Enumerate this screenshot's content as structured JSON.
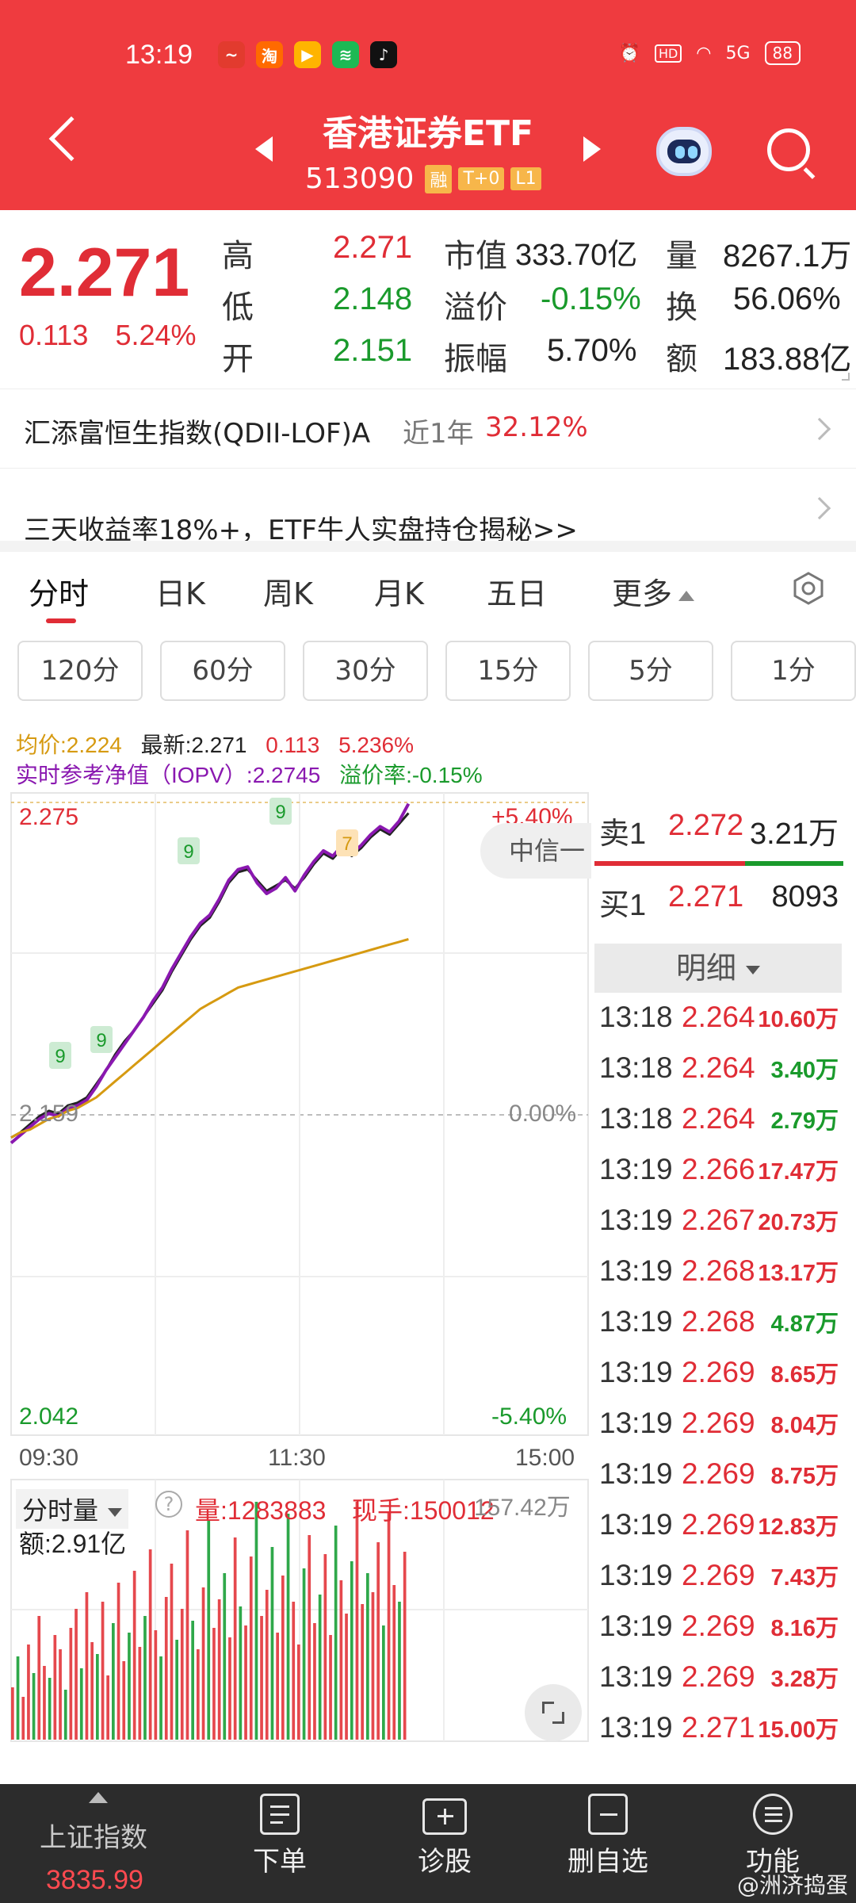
{
  "status_bar": {
    "time": "13:19",
    "battery": "88",
    "signal": "5G"
  },
  "header": {
    "title": "香港证券ETF",
    "code": "513090",
    "tags": [
      "融",
      "T+0",
      "L1"
    ]
  },
  "quote": {
    "price": "2.271",
    "change": "0.113",
    "change_pct": "5.24%",
    "high_label": "高",
    "high": "2.271",
    "low_label": "低",
    "low": "2.148",
    "open_label": "开",
    "open": "2.151",
    "mktcap_label": "市值",
    "mktcap": "333.70亿",
    "premium_label": "溢价",
    "premium": "-0.15%",
    "amplitude_label": "振幅",
    "amplitude": "5.70%",
    "volume_label": "量",
    "volume": "8267.1万",
    "turnover_label": "换",
    "turnover": "56.06%",
    "amount_label": "额",
    "amount": "183.88亿"
  },
  "related": {
    "name": "汇添富恒生指数(QDII-LOF)A",
    "period": "近1年",
    "return": "32.12%"
  },
  "promo": {
    "text": "三天收益率18%+，ETF牛人实盘持仓揭秘>>"
  },
  "tabs": [
    "分时",
    "日K",
    "周K",
    "月K",
    "五日",
    "更多"
  ],
  "periods": [
    "120分",
    "60分",
    "30分",
    "15分",
    "5分",
    "1分"
  ],
  "chart_info": {
    "avg": "均价:2.224",
    "latest": "最新:2.271",
    "chg": "0.113",
    "chg_pct": "5.236%",
    "iopv": "实时参考净值（IOPV）:2.2745",
    "premium_rate": "溢价率:-0.15%"
  },
  "chart_axes": {
    "y_top": "2.275",
    "y_mid": "2.159",
    "y_bottom": "2.042",
    "pct_top": "+5.40%",
    "pct_mid": "0.00%",
    "pct_bottom": "-5.40%",
    "x_start": "09:30",
    "x_mid": "11:30",
    "x_end": "15:00",
    "marker_9": "9",
    "marker_7": "7",
    "broker_tag": "中信一"
  },
  "chart_data": {
    "type": "line",
    "x_range": [
      "09:30",
      "15:00"
    ],
    "ylim": [
      2.042,
      2.275
    ],
    "series": [
      {
        "name": "最新",
        "color": "#222222",
        "values": [
          2.15,
          2.152,
          2.155,
          2.158,
          2.16,
          2.159,
          2.162,
          2.163,
          2.165,
          2.17,
          2.175,
          2.181,
          2.186,
          2.19,
          2.195,
          2.2,
          2.205,
          2.212,
          2.218,
          2.224,
          2.229,
          2.232,
          2.238,
          2.245,
          2.249,
          2.25,
          2.246,
          2.242,
          2.244,
          2.246,
          2.243,
          2.247,
          2.252,
          2.256,
          2.254,
          2.258,
          2.255,
          2.258,
          2.262,
          2.265,
          2.263,
          2.267,
          2.271
        ]
      },
      {
        "name": "IOPV",
        "color": "#8a18b0",
        "values": [
          2.148,
          2.151,
          2.154,
          2.157,
          2.159,
          2.158,
          2.161,
          2.162,
          2.164,
          2.169,
          2.175,
          2.18,
          2.185,
          2.19,
          2.195,
          2.201,
          2.206,
          2.213,
          2.219,
          2.225,
          2.23,
          2.233,
          2.239,
          2.246,
          2.25,
          2.251,
          2.245,
          2.241,
          2.243,
          2.247,
          2.242,
          2.248,
          2.253,
          2.257,
          2.255,
          2.259,
          2.256,
          2.259,
          2.263,
          2.266,
          2.264,
          2.268,
          2.2745
        ]
      },
      {
        "name": "均价",
        "color": "#d69a11",
        "values": [
          2.15,
          2.152,
          2.153,
          2.155,
          2.157,
          2.158,
          2.16,
          2.161,
          2.163,
          2.165,
          2.168,
          2.171,
          2.174,
          2.177,
          2.18,
          2.183,
          2.186,
          2.189,
          2.192,
          2.195,
          2.198,
          2.2,
          2.202,
          2.204,
          2.206,
          2.207,
          2.208,
          2.209,
          2.21,
          2.211,
          2.212,
          2.213,
          2.214,
          2.215,
          2.216,
          2.217,
          2.218,
          2.219,
          2.22,
          2.221,
          2.222,
          2.223,
          2.224
        ]
      }
    ]
  },
  "volume_info": {
    "label": "分时量",
    "amount": "额:2.91亿",
    "vol": "量:1283883",
    "hand": "现手:150012",
    "max": "157.42万"
  },
  "volume_data": [
    22,
    35,
    18,
    40,
    28,
    52,
    31,
    26,
    44,
    38,
    21,
    47,
    55,
    30,
    62,
    41,
    36,
    58,
    27,
    49,
    66,
    33,
    45,
    71,
    39,
    52,
    80,
    46,
    35,
    60,
    74,
    42,
    55,
    88,
    50,
    38,
    64,
    92,
    47,
    59,
    70,
    43,
    85,
    56,
    48,
    77,
    100,
    52,
    63,
    81,
    45,
    69,
    95,
    58,
    40,
    72,
    86,
    49,
    61,
    78,
    44,
    90,
    67,
    53,
    75,
    100,
    57,
    70,
    62,
    83,
    48,
    96,
    65,
    58,
    79
  ],
  "order_book": {
    "sell_label": "卖1",
    "sell_price": "2.272",
    "sell_vol": "3.21万",
    "buy_label": "买1",
    "buy_price": "2.271",
    "buy_vol": "8093",
    "detail_label": "明细"
  },
  "ticks": [
    {
      "time": "13:18",
      "price": "2.264",
      "vol": "10.60万",
      "dir": "red"
    },
    {
      "time": "13:18",
      "price": "2.264",
      "vol": "3.40万",
      "dir": "green"
    },
    {
      "time": "13:18",
      "price": "2.264",
      "vol": "2.79万",
      "dir": "green"
    },
    {
      "time": "13:19",
      "price": "2.266",
      "vol": "17.47万",
      "dir": "red"
    },
    {
      "time": "13:19",
      "price": "2.267",
      "vol": "20.73万",
      "dir": "red"
    },
    {
      "time": "13:19",
      "price": "2.268",
      "vol": "13.17万",
      "dir": "red"
    },
    {
      "time": "13:19",
      "price": "2.268",
      "vol": "4.87万",
      "dir": "green"
    },
    {
      "time": "13:19",
      "price": "2.269",
      "vol": "8.65万",
      "dir": "red"
    },
    {
      "time": "13:19",
      "price": "2.269",
      "vol": "8.04万",
      "dir": "red"
    },
    {
      "time": "13:19",
      "price": "2.269",
      "vol": "8.75万",
      "dir": "red"
    },
    {
      "time": "13:19",
      "price": "2.269",
      "vol": "12.83万",
      "dir": "red"
    },
    {
      "time": "13:19",
      "price": "2.269",
      "vol": "7.43万",
      "dir": "red"
    },
    {
      "time": "13:19",
      "price": "2.269",
      "vol": "8.16万",
      "dir": "red"
    },
    {
      "time": "13:19",
      "price": "2.269",
      "vol": "3.28万",
      "dir": "red"
    },
    {
      "time": "13:19",
      "price": "2.271",
      "vol": "15.00万",
      "dir": "red"
    }
  ],
  "bottom_nav": {
    "index_name": "上证指数",
    "index_value": "3835.99",
    "order": "下单",
    "diagnose": "诊股",
    "remove_fav": "删自选",
    "function": "功能"
  },
  "watermark": "@洲济捣蛋"
}
